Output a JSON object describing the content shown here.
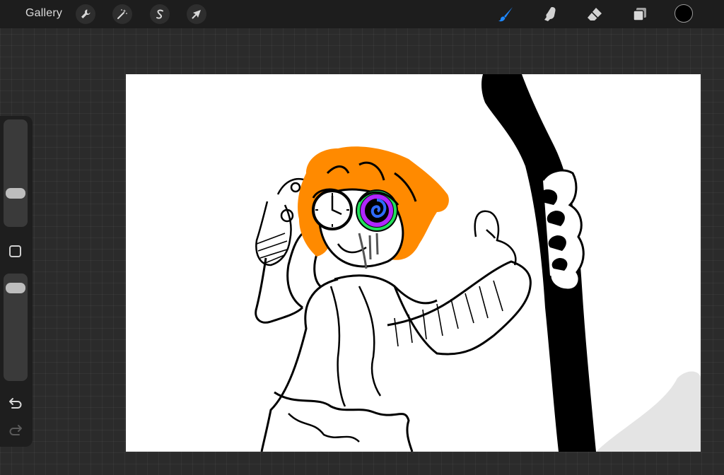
{
  "topbar": {
    "gallery_label": "Gallery",
    "left_tools": [
      {
        "name": "actions",
        "icon": "wrench-icon"
      },
      {
        "name": "adjustments",
        "icon": "magic-wand-icon"
      },
      {
        "name": "selection",
        "icon": "selection-s-icon"
      },
      {
        "name": "transform",
        "icon": "arrow-cursor-icon"
      }
    ],
    "right_tools": [
      {
        "name": "brush",
        "icon": "brush-icon",
        "active": true
      },
      {
        "name": "smudge",
        "icon": "smudge-finger-icon",
        "active": false
      },
      {
        "name": "eraser",
        "icon": "eraser-icon",
        "active": false
      },
      {
        "name": "layers",
        "icon": "layers-icon",
        "active": false
      }
    ],
    "current_color": "#000000"
  },
  "sidebar": {
    "brush_size_level": 0.28,
    "opacity_level": 0.92,
    "undo_icon": "undo-icon",
    "redo_icon": "redo-icon"
  },
  "canvas": {
    "background": "#ffffff",
    "content": "drawing-artwork"
  },
  "colors": {
    "accent_blue": "#1e88ff",
    "hair_orange": "#ff8a00",
    "spiral_purple": "#b026ff",
    "spiral_green": "#22e05a",
    "spiral_blue": "#2f6bff"
  }
}
